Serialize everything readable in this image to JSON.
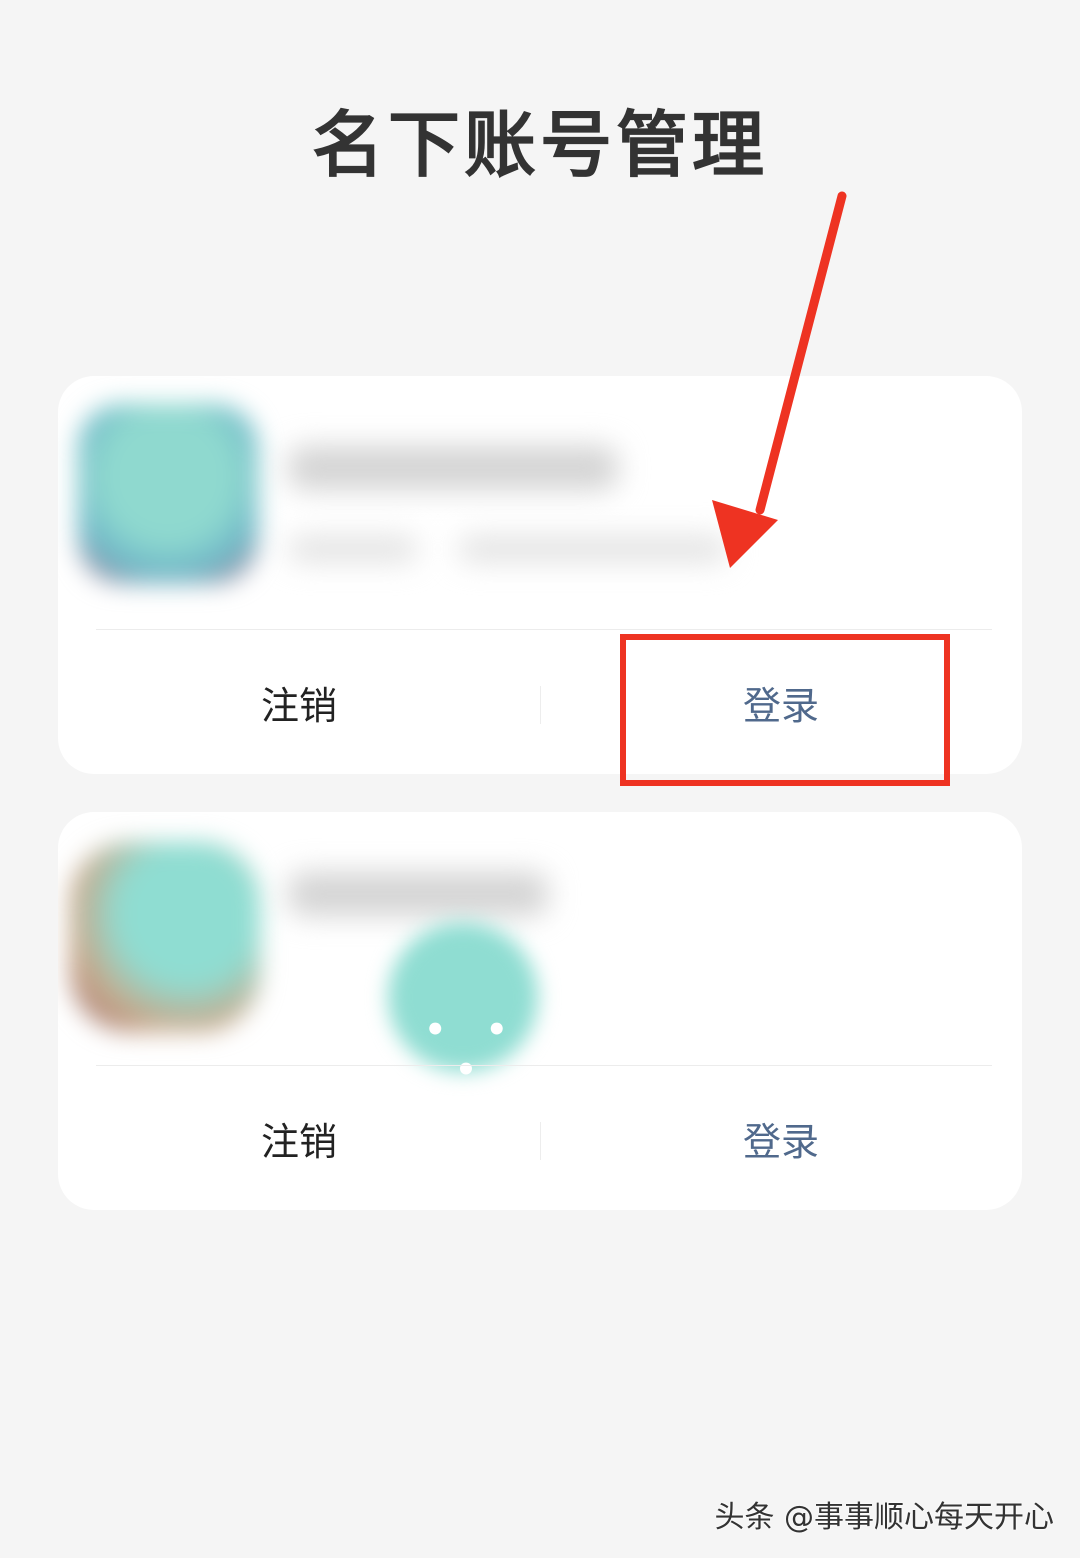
{
  "title": "名下账号管理",
  "accounts": [
    {
      "logout_label": "注销",
      "login_label": "登录"
    },
    {
      "logout_label": "注销",
      "login_label": "登录",
      "status_dots": "• • •"
    }
  ],
  "watermark": "头条 @事事顺心每天开心",
  "colors": {
    "background": "#f5f5f5",
    "card": "#ffffff",
    "login_text": "#50698c",
    "annotation_red": "#ee3322"
  },
  "icons": {
    "annotation": "red-arrow-icon"
  }
}
